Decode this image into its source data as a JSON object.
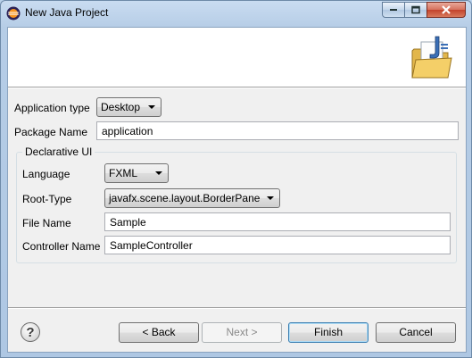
{
  "window": {
    "title": "New Java Project"
  },
  "form": {
    "application_type": {
      "label": "Application type",
      "value": "Desktop"
    },
    "package_name": {
      "label": "Package Name",
      "value": "application"
    },
    "declarative_ui": {
      "title": "Declarative UI",
      "language": {
        "label": "Language",
        "value": "FXML"
      },
      "root_type": {
        "label": "Root-Type",
        "value": "javafx.scene.layout.BorderPane"
      },
      "file_name": {
        "label": "File Name",
        "value": "Sample"
      },
      "controller_name": {
        "label": "Controller Name",
        "value": "SampleController"
      }
    }
  },
  "buttons": {
    "help": "?",
    "back": "< Back",
    "next": "Next >",
    "finish": "Finish",
    "cancel": "Cancel"
  },
  "icons": {
    "title": "eclipse-icon",
    "banner": "java-project-folder-icon",
    "minimize": "minimize-icon",
    "maximize": "maximize-icon",
    "close": "close-icon"
  },
  "colors": {
    "title_bar": "#b9d1ea",
    "close_button": "#c3432c",
    "default_button_border": "#3c7fb1"
  }
}
